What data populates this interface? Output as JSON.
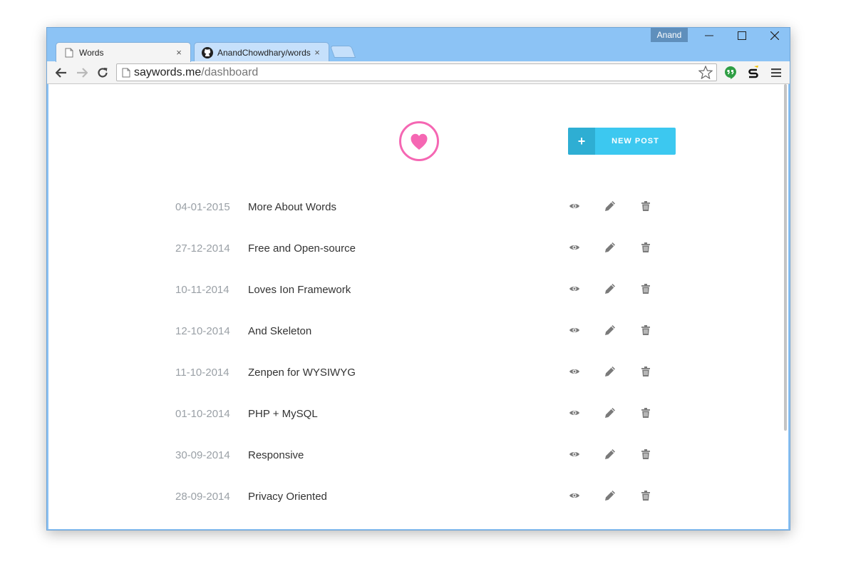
{
  "window": {
    "user": "Anand"
  },
  "tabs": [
    {
      "label": "Words",
      "close": "×",
      "icon": "page-icon"
    },
    {
      "label": "AnandChowdhary/words",
      "close": "×",
      "icon": "github-icon"
    }
  ],
  "address_bar": {
    "host": "saywords.me",
    "path": "/dashboard"
  },
  "page": {
    "logo_icon": "heart-icon",
    "logo_color": "#f567b3",
    "new_post": {
      "plus": "+",
      "label": "NEW POST",
      "color": "#3cc8f0"
    },
    "posts": [
      {
        "date": "04-01-2015",
        "title": "More About Words"
      },
      {
        "date": "27-12-2014",
        "title": "Free and Open-source"
      },
      {
        "date": "10-11-2014",
        "title": "Loves Ion Framework"
      },
      {
        "date": "12-10-2014",
        "title": "And Skeleton"
      },
      {
        "date": "11-10-2014",
        "title": "Zenpen for WYSIWYG"
      },
      {
        "date": "01-10-2014",
        "title": "PHP + MySQL"
      },
      {
        "date": "30-09-2014",
        "title": "Responsive"
      },
      {
        "date": "28-09-2014",
        "title": "Privacy Oriented"
      }
    ],
    "row_actions": [
      "eye-icon",
      "pencil-icon",
      "trash-icon"
    ]
  }
}
